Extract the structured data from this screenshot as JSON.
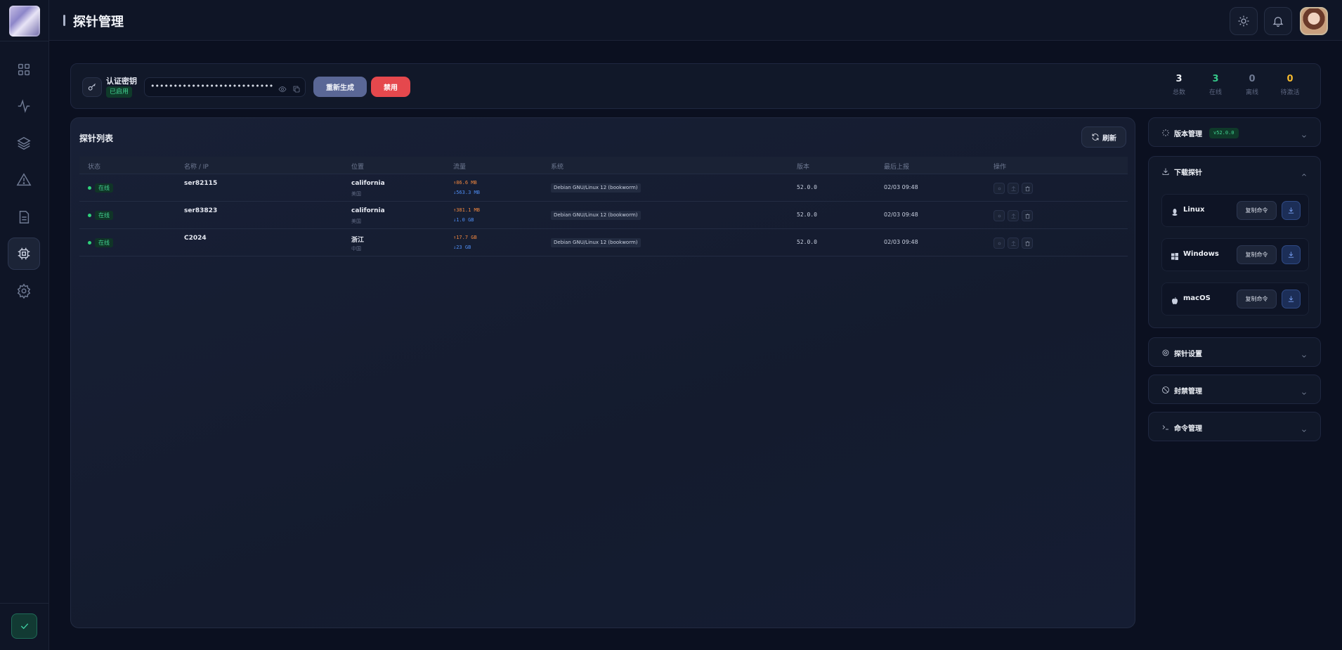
{
  "header": {
    "title": "探针管理"
  },
  "sidebar": {
    "items": [
      {
        "name": "dashboard",
        "icon": "grid-icon"
      },
      {
        "name": "monitor",
        "icon": "activity-icon"
      },
      {
        "name": "layers",
        "icon": "layers-icon"
      },
      {
        "name": "alerts",
        "icon": "warning-icon"
      },
      {
        "name": "docs",
        "icon": "document-icon"
      },
      {
        "name": "probes",
        "icon": "chip-icon",
        "active": true
      },
      {
        "name": "settings",
        "icon": "gear-icon"
      }
    ]
  },
  "keybar": {
    "label": "认证密钥",
    "status": "已启用",
    "masked_key": "••••••••••••••••••••••••••••••••••••••••",
    "regenerate": "重新生成",
    "disable": "禁用"
  },
  "stats": [
    {
      "value": "3",
      "label": "总数",
      "color": "#eef1f7"
    },
    {
      "value": "3",
      "label": "在线",
      "color": "#36c98a"
    },
    {
      "value": "0",
      "label": "离线",
      "color": "#6f7a93"
    },
    {
      "value": "0",
      "label": "待激活",
      "color": "#f5b92e"
    }
  ],
  "probe_list": {
    "title": "探针列表",
    "refresh": "刷新",
    "columns": [
      "状态",
      "名称 / IP",
      "位置",
      "流量",
      "系统",
      "版本",
      "最后上报",
      "操作"
    ],
    "rows": [
      {
        "status": "在线",
        "name": "ser82115",
        "location": "california",
        "location_sub": "美国",
        "up": "↑86.6 MB",
        "down": "↓563.3 MB",
        "os": "Debian GNU/Linux 12 (bookworm)",
        "version": "52.0.0",
        "last": "02/03 09:48"
      },
      {
        "status": "在线",
        "name": "ser83823",
        "location": "california",
        "location_sub": "美国",
        "up": "↑381.1 MB",
        "down": "↓1.0 GB",
        "os": "Debian GNU/Linux 12 (bookworm)",
        "version": "52.0.0",
        "last": "02/03 09:48"
      },
      {
        "status": "在线",
        "name": "C2024",
        "location": "浙江",
        "location_sub": "中国",
        "up": "↑17.7 GB",
        "down": "↓23 GB",
        "os": "Debian GNU/Linux 12 (bookworm)",
        "version": "52.0.0",
        "last": "02/03 09:48"
      }
    ]
  },
  "version_panel": {
    "title": "版本管理",
    "version": "v52.0.0"
  },
  "download_panel": {
    "title": "下载探针",
    "copy_label": "复制命令",
    "items": [
      {
        "os": "Linux",
        "icon": "linux-icon"
      },
      {
        "os": "Windows",
        "icon": "windows-icon"
      },
      {
        "os": "macOS",
        "icon": "apple-icon"
      }
    ]
  },
  "settings_panel": {
    "title": "探针设置"
  },
  "ban_panel": {
    "title": "封禁管理"
  },
  "command_panel": {
    "title": "命令管理"
  }
}
